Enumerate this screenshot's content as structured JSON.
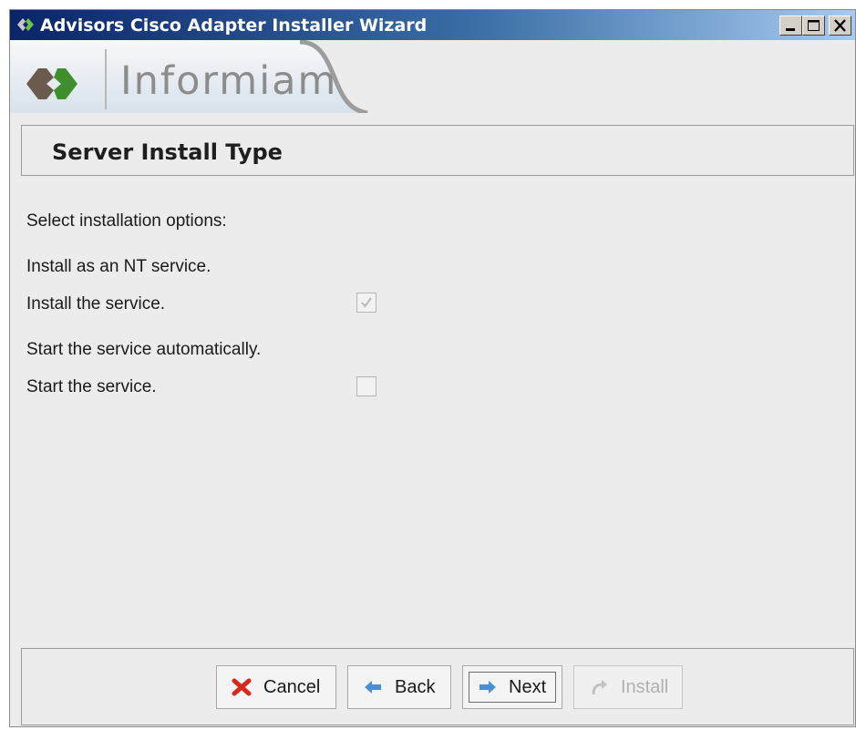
{
  "window": {
    "title": "Advisors Cisco Adapter Installer Wizard",
    "controls": [
      "minimize-icon",
      "maximize-icon",
      "close-icon"
    ]
  },
  "banner": {
    "logo_text": "Informiam"
  },
  "page": {
    "title": "Server Install Type",
    "intro": "Select installation options:",
    "nt_service_heading": "Install as an NT service.",
    "install_service_label": "Install the service.",
    "install_service_checked": true,
    "install_service_enabled": false,
    "auto_start_heading": "Start the service automatically.",
    "start_service_label": "Start the service.",
    "start_service_checked": false,
    "start_service_enabled": false
  },
  "footer": {
    "cancel_label": "Cancel",
    "back_label": "Back",
    "next_label": "Next",
    "install_label": "Install",
    "install_enabled": false
  },
  "colors": {
    "titlebar_start": "#0a246a",
    "titlebar_end": "#a6caf0",
    "logo_green": "#3f8f2e",
    "logo_brown": "#6b5a4e",
    "window_bg": "#ececec"
  }
}
